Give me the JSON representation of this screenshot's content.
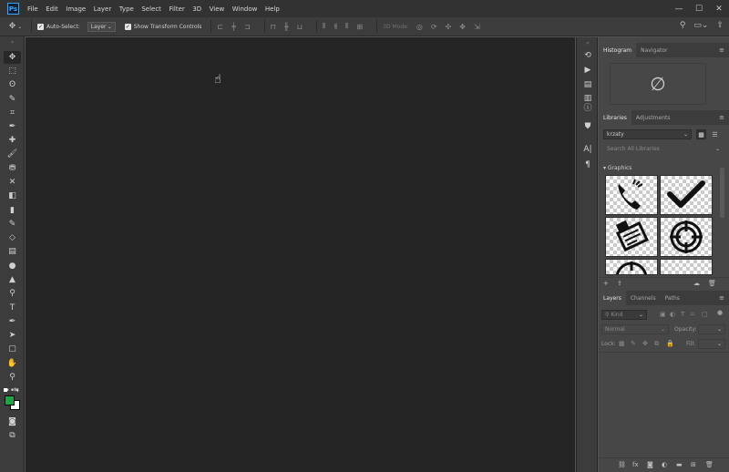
{
  "app": {
    "logo_text": "Ps"
  },
  "menu": [
    "File",
    "Edit",
    "Image",
    "Layer",
    "Type",
    "Select",
    "Filter",
    "3D",
    "View",
    "Window",
    "Help"
  ],
  "window_controls": {
    "minimize": "—",
    "maximize": "☐",
    "close": "✕"
  },
  "options_bar": {
    "auto_select_label": "Auto-Select:",
    "auto_select_checked": true,
    "auto_select_target": "Layer",
    "transform_controls_label": "Show Transform Controls",
    "transform_controls_checked": true,
    "mode_3d_label": "3D Mode:"
  },
  "toolbar": {
    "tools": [
      "move-tool",
      "marquee-tool",
      "lasso-tool",
      "quick-select-tool",
      "crop-tool",
      "eyedropper-tool",
      "healing-brush-tool",
      "brush-tool",
      "clone-stamp-tool",
      "history-brush-tool",
      "eraser-tool",
      "gradient-tool",
      "blur-tool",
      "dodge-tool",
      "pen-tool",
      "type-tool",
      "path-selection-tool",
      "shape-tool",
      "hand-tool",
      "zoom-tool",
      "more-tools"
    ],
    "foreground_color": "#1fa345",
    "background_color": "#ffffff"
  },
  "histogram_panel": {
    "tabs": [
      "Histogram",
      "Navigator"
    ],
    "active_tab": "Histogram",
    "empty_symbol": "∅"
  },
  "libraries_panel": {
    "tabs": [
      "Libraries",
      "Adjustments"
    ],
    "active_tab": "Libraries",
    "library_name": "krzaty",
    "search_placeholder": "Search All Libraries",
    "section_title": "Graphics",
    "graphics": [
      "phone-graphic",
      "checkmark-graphic",
      "notes-graphic",
      "target-graphic",
      "target-graphic-2",
      "blank-graphic"
    ]
  },
  "layers_panel": {
    "tabs": [
      "Layers",
      "Channels",
      "Paths"
    ],
    "active_tab": "Layers",
    "filter_placeholder": "Kind",
    "blend_mode": "Normal",
    "opacity_label": "Opacity:",
    "lock_label": "Lock:",
    "fill_label": "Fill:"
  },
  "colors": {
    "accent": "#31a8ff",
    "canvas": "#252525",
    "panel": "#474747",
    "chrome": "#3c3c3c"
  }
}
